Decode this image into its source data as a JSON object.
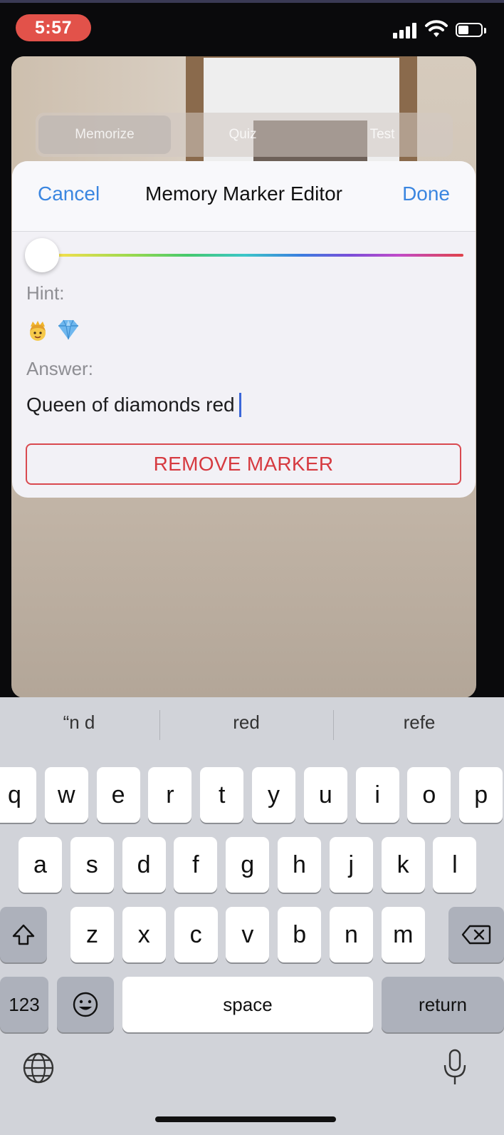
{
  "status_bar": {
    "time": "5:57",
    "battery_level": 0.45
  },
  "background": {
    "segmented_control": {
      "items": [
        "Memorize",
        "Quiz",
        "Test"
      ],
      "selected": "Memorize"
    }
  },
  "editor": {
    "cancel_label": "Cancel",
    "title": "Memory Marker Editor",
    "done_label": "Done",
    "color_slider_value": 0.0,
    "hint_label": "Hint:",
    "hint_emojis": [
      "princess-icon",
      "gem-icon"
    ],
    "answer_label": "Answer:",
    "answer_value": "Queen of diamonds red",
    "remove_label": "REMOVE MARKER",
    "colors": {
      "accent": "#3b86e0",
      "destructive": "#d63a40"
    }
  },
  "keyboard": {
    "predictions": [
      "“n d",
      "red",
      "refe"
    ],
    "row1": [
      "q",
      "w",
      "e",
      "r",
      "t",
      "y",
      "u",
      "i",
      "o",
      "p"
    ],
    "row2": [
      "a",
      "s",
      "d",
      "f",
      "g",
      "h",
      "j",
      "k",
      "l"
    ],
    "row3": [
      "z",
      "x",
      "c",
      "v",
      "b",
      "n",
      "m"
    ],
    "numbers_label": "123",
    "space_label": "space",
    "return_label": "return"
  }
}
